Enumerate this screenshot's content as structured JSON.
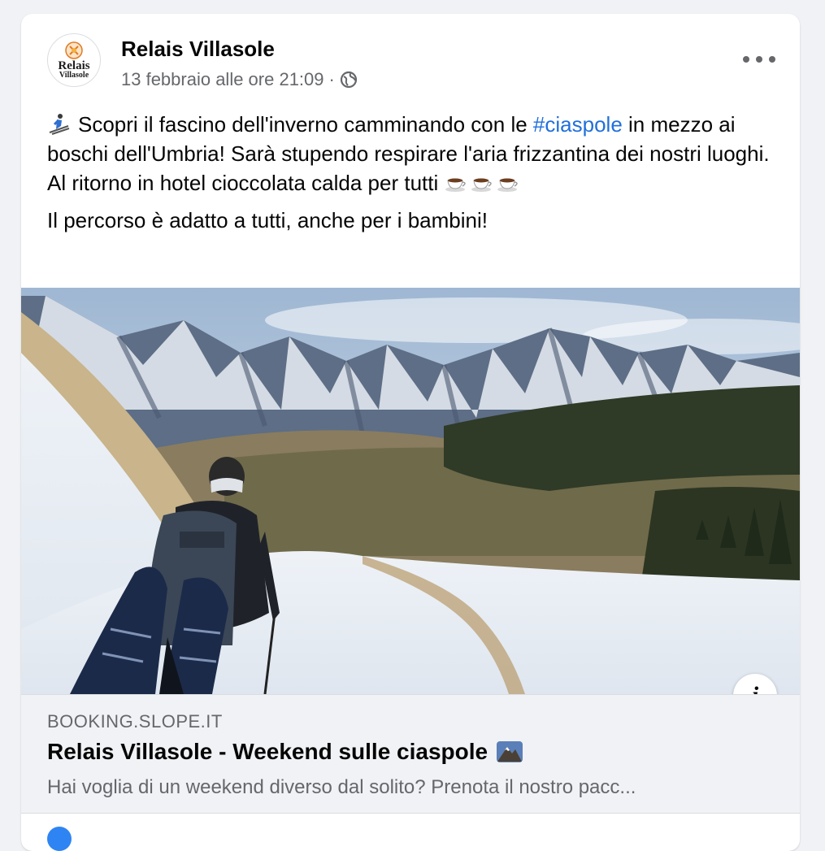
{
  "post": {
    "author": "Relais Villasole",
    "avatar_text_line1": "Relais",
    "avatar_text_line2": "Villasole",
    "timestamp": "13 febbraio alle ore 21:09",
    "separator": "·",
    "audience_icon": "globe-icon",
    "more_icon": "more-options-icon",
    "text": {
      "line1_start": "Scopri il fascino dell'inverno camminando con le ",
      "hashtag": "#ciaspole",
      "line1_end": " in mezzo ai boschi dell'Umbria! Sarà stupendo respirare l'aria frizzantina dei nostri luoghi.",
      "line2": "Al ritorno in hotel cioccolata calda per tutti",
      "line3": "Il percorso è adatto a tutti, anche per i bambini!"
    }
  },
  "link_preview": {
    "domain": "BOOKING.SLOPE.IT",
    "title": "Relais Villasole - Weekend sulle ciaspole",
    "description": "Hai voglia di un weekend diverso dal solito? Prenota il nostro pacc...",
    "info_label": "i"
  },
  "colors": {
    "hashtag": "#216fdb",
    "secondary_text": "#65676b",
    "card_bg": "#ffffff",
    "preview_bg": "#f0f2f5"
  }
}
